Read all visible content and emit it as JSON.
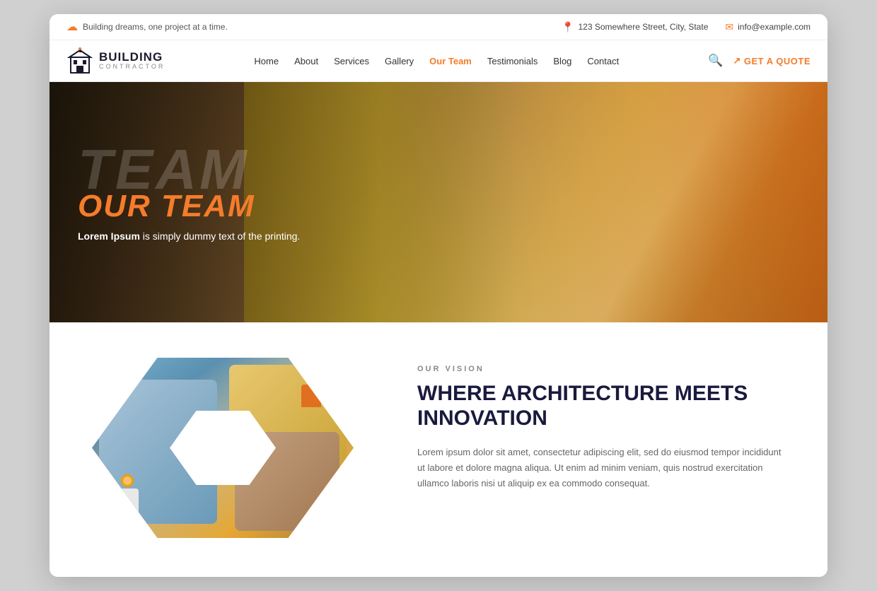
{
  "topbar": {
    "tagline": "Building dreams, one project at a time.",
    "address": "123 Somewhere Street, City, State",
    "email": "info@example.com"
  },
  "header": {
    "logo": {
      "brand_name": "BUILDING",
      "brand_sub": "CONTRACTOR"
    },
    "nav": [
      {
        "label": "Home",
        "active": false
      },
      {
        "label": "About",
        "active": false
      },
      {
        "label": "Services",
        "active": false
      },
      {
        "label": "Gallery",
        "active": false
      },
      {
        "label": "Our Team",
        "active": true
      },
      {
        "label": "Testimonials",
        "active": false
      },
      {
        "label": "Blog",
        "active": false
      },
      {
        "label": "Contact",
        "active": false
      }
    ],
    "get_quote": "GET A QUOTE"
  },
  "hero": {
    "bg_text": "TEAM",
    "title": "OUR TEAM",
    "subtitle_bold": "Lorem Ipsum",
    "subtitle_rest": " is simply dummy text of the printing."
  },
  "vision": {
    "label": "OUR VISION",
    "title_line1": "WHERE ARCHITECTURE MEETS",
    "title_line2": "INNOVATION",
    "body": "Lorem ipsum dolor sit amet, consectetur adipiscing elit, sed do eiusmod tempor incididunt ut labore et dolore magna aliqua. Ut enim ad minim veniam, quis nostrud exercitation ullamco laboris nisi ut aliquip ex ea commodo consequat."
  },
  "colors": {
    "accent": "#f57c2b",
    "dark_blue": "#1a1a3e",
    "light_gray": "#888888"
  }
}
